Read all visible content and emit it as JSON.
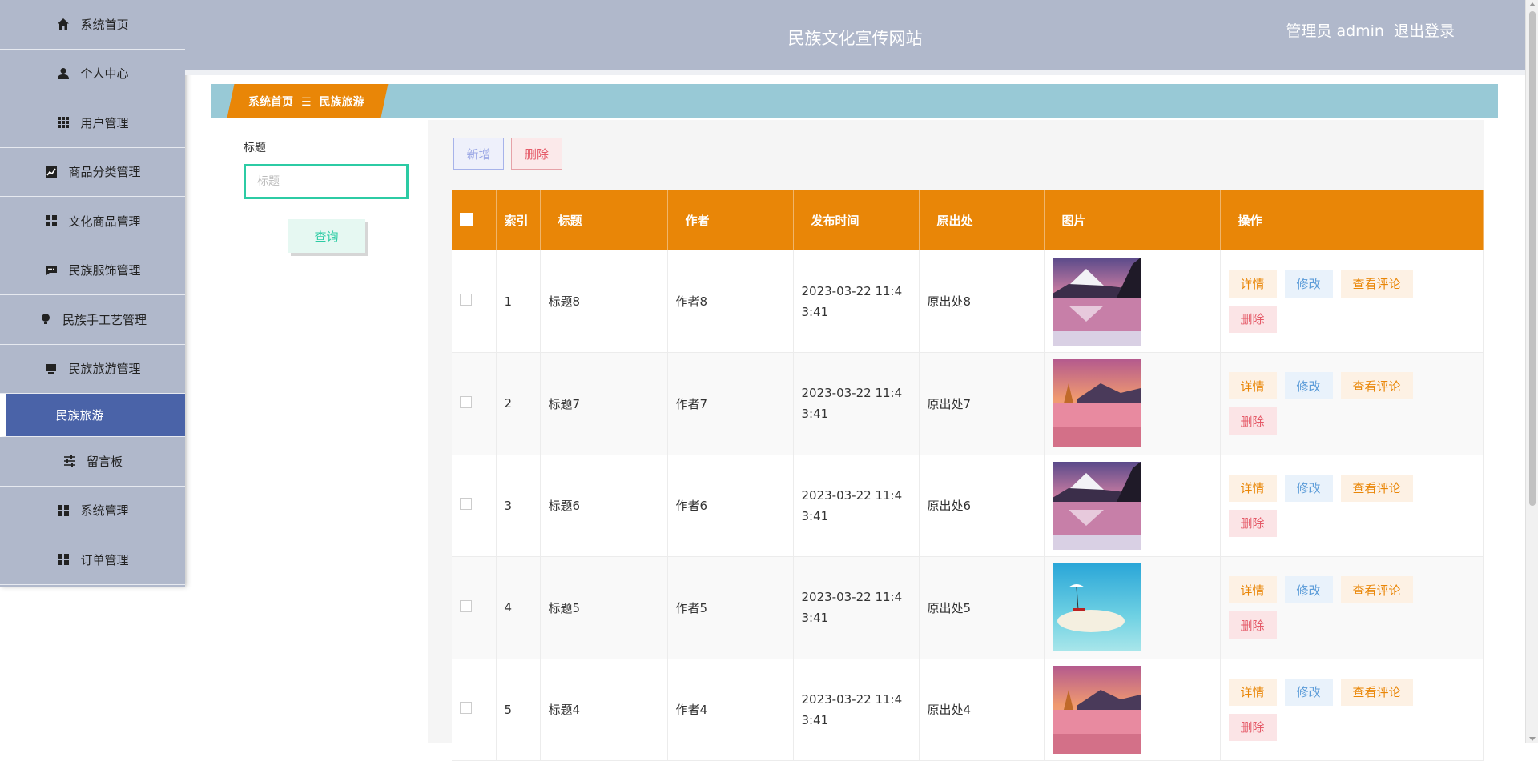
{
  "header": {
    "site_title": "民族文化宣传网站",
    "user_label": "管理员 admin",
    "logout_label": "退出登录"
  },
  "sidebar": {
    "items": [
      {
        "label": "系统首页",
        "icon": "home-icon"
      },
      {
        "label": "个人中心",
        "icon": "user-icon"
      },
      {
        "label": "用户管理",
        "icon": "grid-icon"
      },
      {
        "label": "商品分类管理",
        "icon": "chart-icon"
      },
      {
        "label": "文化商品管理",
        "icon": "grid-icon"
      },
      {
        "label": "民族服饰管理",
        "icon": "chat-icon"
      },
      {
        "label": "民族手工艺管理",
        "icon": "bulb-icon"
      },
      {
        "label": "民族旅游管理",
        "icon": "monitor-icon"
      },
      {
        "label": "民族旅游",
        "icon": "",
        "active": true
      },
      {
        "label": "留言板",
        "icon": "sliders-icon"
      },
      {
        "label": "系统管理",
        "icon": "grid-icon"
      },
      {
        "label": "订单管理",
        "icon": "grid-icon"
      }
    ]
  },
  "breadcrumb": {
    "home": "系统首页",
    "separator": "☰",
    "current": "民族旅游"
  },
  "search": {
    "label": "标题",
    "placeholder": "标题",
    "value": "",
    "button": "查询"
  },
  "toolbar": {
    "add_label": "新增",
    "delete_label": "删除"
  },
  "table": {
    "headers": {
      "index": "索引",
      "title": "标题",
      "author": "作者",
      "publish_time": "发布时间",
      "source": "原出处",
      "image": "图片",
      "actions": "操作"
    },
    "actions": {
      "detail": "详情",
      "edit": "修改",
      "comments": "查看评论",
      "delete": "删除"
    },
    "rows": [
      {
        "index": "1",
        "title": "标题8",
        "author": "作者8",
        "time1": "2023-03-22 11:4",
        "time2": "3:41",
        "source": "原出处8",
        "image": "mountain-lake"
      },
      {
        "index": "2",
        "title": "标题7",
        "author": "作者7",
        "time1": "2023-03-22 11:4",
        "time2": "3:41",
        "source": "原出处7",
        "image": "sunset-lake"
      },
      {
        "index": "3",
        "title": "标题6",
        "author": "作者6",
        "time1": "2023-03-22 11:4",
        "time2": "3:41",
        "source": "原出处6",
        "image": "mountain-lake"
      },
      {
        "index": "4",
        "title": "标题5",
        "author": "作者5",
        "time1": "2023-03-22 11:4",
        "time2": "3:41",
        "source": "原出处5",
        "image": "beach"
      },
      {
        "index": "5",
        "title": "标题4",
        "author": "作者4",
        "time1": "2023-03-22 11:4",
        "time2": "3:41",
        "source": "原出处4",
        "image": "sunset-lake"
      }
    ]
  },
  "colors": {
    "accent": "#e98607",
    "sidebar": "#b0b8cb",
    "active": "#4a63a8",
    "breadcrumb_bar": "#98c9d6",
    "search_border": "#2ccba4"
  }
}
